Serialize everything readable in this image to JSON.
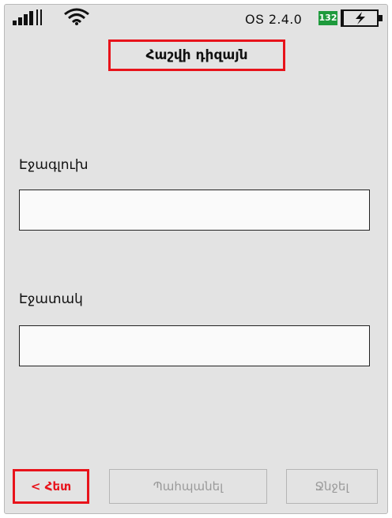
{
  "status_bar": {
    "os_version": "ՕՏ 2.4.0",
    "battery_level": "132",
    "colors": {
      "battery_badge": "#1e9a3c"
    }
  },
  "header": {
    "title": "Հաշվի դիզայն",
    "highlight_color": "#e8131b"
  },
  "form": {
    "first_name_label": "Էջագլուխ",
    "first_name_value": "",
    "last_name_label": "Էջատակ",
    "last_name_value": ""
  },
  "footer": {
    "back_label": "< Հետ",
    "save_label": "Պահպանել",
    "delete_label": "Ջնջել"
  },
  "icons": {
    "signal": "signal-strength-icon",
    "wifi": "wifi-icon",
    "battery": "battery-charging-icon"
  }
}
